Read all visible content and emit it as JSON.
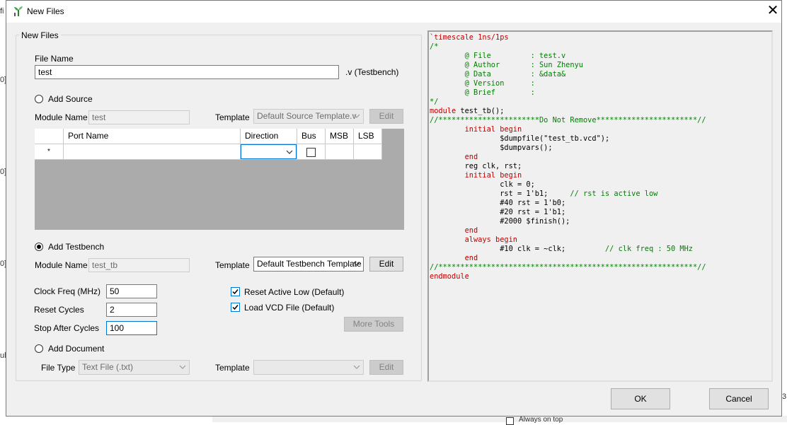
{
  "window": {
    "title": "New Files",
    "close_glyph": "✕"
  },
  "background": {
    "left_glyphs": [
      "fi",
      "0]",
      "0]",
      "0]",
      "ul"
    ],
    "right_glyph": "3",
    "bottom_text": "Always on top"
  },
  "group": {
    "legend": "New Files"
  },
  "file_name": {
    "label": "File Name",
    "value": "test",
    "suffix": ".v (Testbench)"
  },
  "add_source": {
    "label": "Add Source",
    "selected": false,
    "module_name_label": "Module Name",
    "module_name_value": "test",
    "template_label": "Template",
    "template_value": "Default Source Template.v",
    "edit_label": "Edit"
  },
  "port_table": {
    "columns": [
      "Port Name",
      "Direction",
      "Bus",
      "MSB",
      "LSB"
    ],
    "new_row_marker": "*"
  },
  "add_testbench": {
    "label": "Add Testbench",
    "selected": true,
    "module_name_label": "Module Name",
    "module_name_value": "test_tb",
    "template_label": "Template",
    "template_value": "Default Testbench Template",
    "edit_label": "Edit"
  },
  "options": {
    "clock_freq_label": "Clock Freq (MHz)",
    "clock_freq_value": "50",
    "reset_cycles_label": "Reset Cycles",
    "reset_cycles_value": "2",
    "stop_after_label": "Stop After Cycles",
    "stop_after_value": "100",
    "reset_active_low_label": "Reset Active Low (Default)",
    "reset_active_low_checked": true,
    "load_vcd_label": "Load VCD File (Default)",
    "load_vcd_checked": true,
    "more_tools_label": "More Tools"
  },
  "add_document": {
    "label": "Add Document",
    "selected": false,
    "file_type_label": "File Type",
    "file_type_value": "Text File (.txt)",
    "template_label": "Template",
    "template_value": "",
    "edit_label": "Edit"
  },
  "buttons": {
    "ok": "OK",
    "cancel": "Cancel"
  },
  "code_preview": {
    "l01": "`timescale 1ns/1ps",
    "l02": "/*",
    "l03": "        @ File         : test.v",
    "l04": "        @ Author       : Sun Zhenyu",
    "l05": "        @ Data         : &data&",
    "l06": "        @ Version      :",
    "l07": "        @ Brief        :",
    "l08": "*/",
    "l09a": "module",
    "l09b": " test_tb();",
    "l10": "//***********************Do Not Remove***********************//",
    "l11a": "        ",
    "l11b": "initial begin",
    "l12": "                $dumpfile(\"test_tb.vcd\");",
    "l13": "                $dumpvars();",
    "l14a": "        ",
    "l14b": "end",
    "l15": "        reg clk, rst;",
    "l16a": "        ",
    "l16b": "initial begin",
    "l17": "                clk = 0;",
    "l18a": "                rst = 1'b1;     ",
    "l18b": "// rst is active low",
    "l19": "                #40 rst = 1'b0;",
    "l20": "                #20 rst = 1'b1;",
    "l21": "                #2000 $finish();",
    "l22a": "        ",
    "l22b": "end",
    "l23a": "        ",
    "l23b": "always begin",
    "l24a": "                #10 clk = ~clk;         ",
    "l24b": "// clk freq : 50 MHz",
    "l25a": "        ",
    "l25b": "end",
    "l26": "//***********************************************************//",
    "l27": "endmodule"
  }
}
